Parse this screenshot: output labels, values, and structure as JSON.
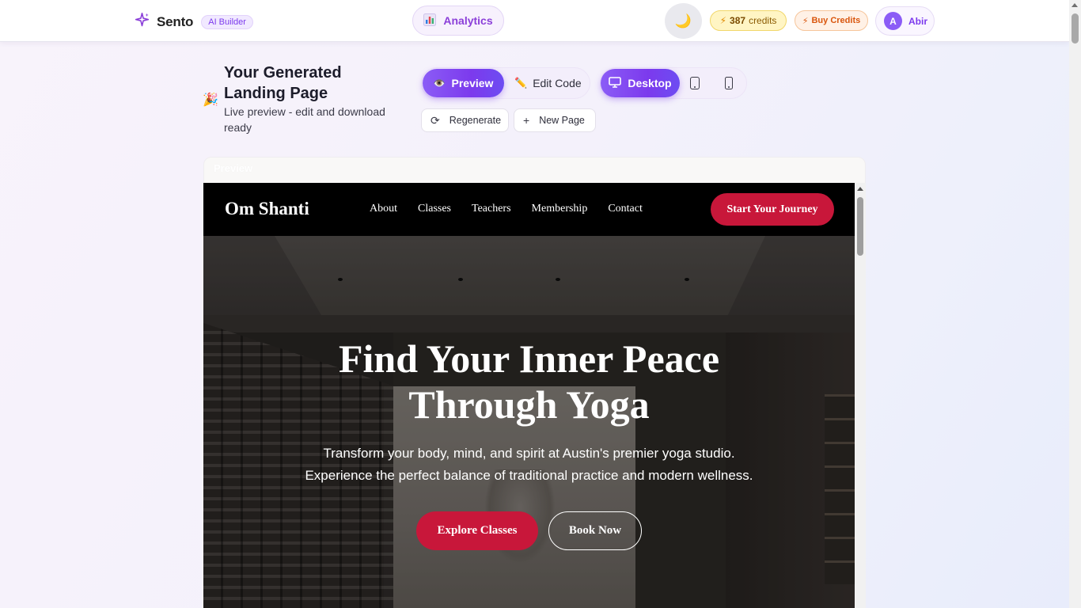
{
  "app": {
    "brand": "Sento",
    "badge": "AI Builder",
    "analytics_label": "Analytics",
    "credits_amount": "387",
    "credits_word": "credits",
    "buy_credits_label": "Buy Credits",
    "user_initial": "A",
    "user_name": "Abir"
  },
  "heading": {
    "title": "Your Generated Landing Page",
    "subtitle": "Live preview - edit and download ready"
  },
  "modes": {
    "preview_label": "Preview",
    "edit_label": "Edit Code",
    "desktop_label": "Desktop"
  },
  "actions": {
    "regenerate_label": "Regenerate",
    "new_page_label": "New Page"
  },
  "preview_frame": {
    "label": "Preview"
  },
  "site": {
    "logo": "Om Shanti",
    "nav": [
      "About",
      "Classes",
      "Teachers",
      "Membership",
      "Contact"
    ],
    "nav_cta": "Start Your Journey",
    "hero_title_line1": "Find Your Inner Peace",
    "hero_title_line2": "Through Yoga",
    "hero_sub_line1": "Transform your body, mind, and spirit at Austin's premier yoga studio.",
    "hero_sub_line2": "Experience the perfect balance of traditional practice and modern wellness.",
    "primary_cta": "Explore Classes",
    "secondary_cta": "Book Now"
  },
  "colors": {
    "accent_purple": "#7c3aed",
    "site_red": "#c8173a"
  }
}
